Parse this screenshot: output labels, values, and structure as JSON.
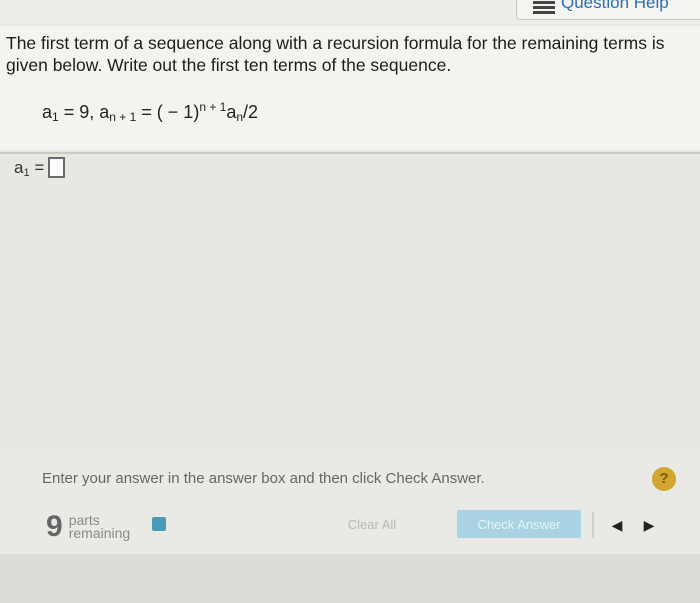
{
  "header": {
    "help_label": "Question Help",
    "help_icon": "list-icon"
  },
  "question": {
    "prompt": "The first term of a sequence along with a recursion formula for the remaining terms is given below. Write out the first ten terms of the sequence.",
    "formula": {
      "a": "a",
      "sub1": "1",
      "eq1": " = 9, a",
      "subn1": "n + 1",
      "eq2": " = ( − 1)",
      "supn1": "n + 1",
      "an": "a",
      "subn": "n",
      "tail": "/2"
    }
  },
  "answer": {
    "label_a": "a",
    "label_sub": "1",
    "label_eq": " =",
    "value": ""
  },
  "footer": {
    "instruction": "Enter your answer in the answer box and then click Check Answer.",
    "help_symbol": "?",
    "parts_count": "9",
    "parts_line1": "parts",
    "parts_line2": "remaining",
    "clear_label": "Clear All",
    "check_label": "Check Answer",
    "prev_icon": "◀",
    "next_icon": "▶"
  },
  "colors": {
    "accent": "#a9d3e3",
    "help_circle": "#d2a72f",
    "swatch": "#4a9bb5"
  }
}
